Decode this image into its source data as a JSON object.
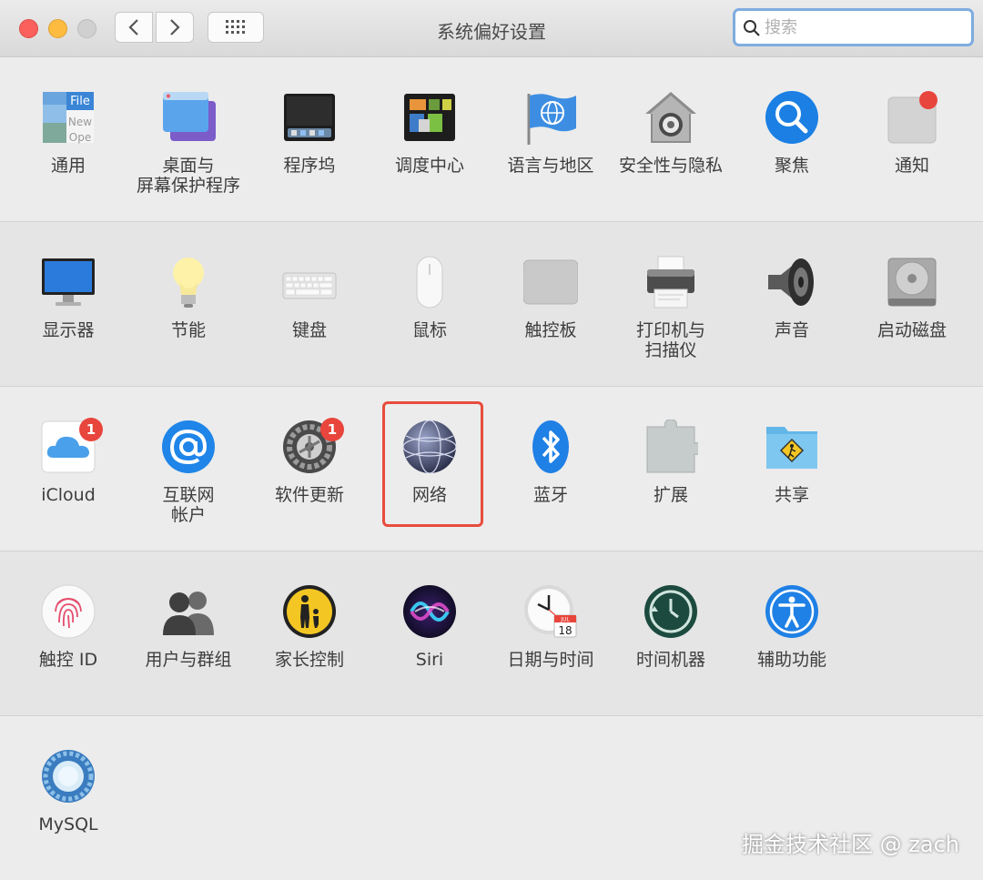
{
  "window": {
    "title": "系统偏好设置"
  },
  "search": {
    "placeholder": "搜索"
  },
  "rows": [
    [
      {
        "label": "通用"
      },
      {
        "label": "桌面与\n屏幕保护程序"
      },
      {
        "label": "程序坞"
      },
      {
        "label": "调度中心"
      },
      {
        "label": "语言与地区"
      },
      {
        "label": "安全性与隐私"
      },
      {
        "label": "聚焦"
      },
      {
        "label": "通知"
      }
    ],
    [
      {
        "label": "显示器"
      },
      {
        "label": "节能"
      },
      {
        "label": "键盘"
      },
      {
        "label": "鼠标"
      },
      {
        "label": "触控板"
      },
      {
        "label": "打印机与\n扫描仪"
      },
      {
        "label": "声音"
      },
      {
        "label": "启动磁盘"
      }
    ],
    [
      {
        "label": "iCloud",
        "badge": "1"
      },
      {
        "label": "互联网\n帐户"
      },
      {
        "label": "软件更新",
        "badge": "1"
      },
      {
        "label": "网络"
      },
      {
        "label": "蓝牙"
      },
      {
        "label": "扩展"
      },
      {
        "label": "共享"
      }
    ],
    [
      {
        "label": "触控 ID"
      },
      {
        "label": "用户与群组"
      },
      {
        "label": "家长控制"
      },
      {
        "label": "Siri"
      },
      {
        "label": "日期与时间"
      },
      {
        "label": "时间机器"
      },
      {
        "label": "辅助功能"
      }
    ],
    [
      {
        "label": "MySQL"
      }
    ]
  ],
  "icons": {
    "general": {
      "file": "File",
      "new": "New",
      "open": "Ope"
    },
    "calendar": {
      "month": "JUL",
      "day": "18"
    }
  },
  "watermark": "掘金技术社区 @ zach"
}
